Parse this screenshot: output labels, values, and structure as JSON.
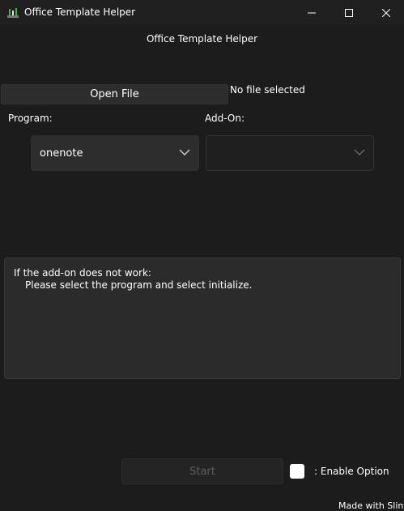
{
  "window": {
    "title": "Office Template Helper",
    "icon": "app-icon"
  },
  "header": {
    "title": "Office Template Helper"
  },
  "file": {
    "open_label": "Open File",
    "status": "No file selected"
  },
  "program": {
    "label": "Program:",
    "selected": "onenote"
  },
  "addon": {
    "label": "Add-On:",
    "selected": ""
  },
  "info": {
    "line1": "If the add-on does not work:",
    "line2": "Please select the program and select initialize."
  },
  "actions": {
    "start_label": "Start",
    "start_enabled": false,
    "option_label": ": Enable Option",
    "option_checked": false
  },
  "footer": {
    "text": "Made with Slint"
  },
  "colors": {
    "background": "#1c1c1c",
    "titlebar": "#202020",
    "control": "#2d2d2d",
    "text": "#ffffff",
    "disabled_text": "#5e5e5e"
  }
}
